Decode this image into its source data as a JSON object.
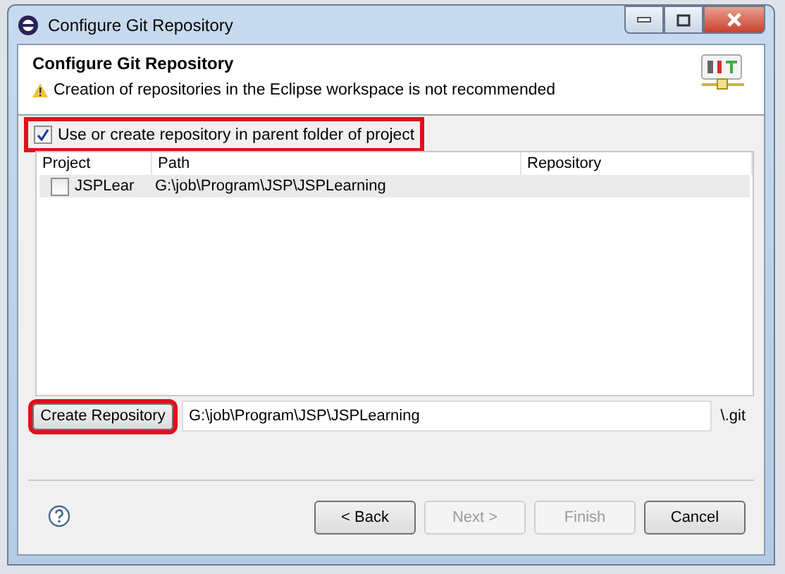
{
  "window": {
    "title": "Configure Git Repository"
  },
  "header": {
    "title": "Configure Git Repository",
    "warning": "Creation of repositories in the Eclipse workspace is not recommended"
  },
  "parent_folder_option": {
    "label": "Use or create repository in parent folder of project",
    "checked": true,
    "highlighted": true
  },
  "table": {
    "columns": [
      "Project",
      "Path",
      "Repository"
    ],
    "rows": [
      {
        "project": "JSPLear",
        "path": "G:\\job\\Program\\JSP\\JSPLearning",
        "checked": false
      }
    ]
  },
  "create_repository": {
    "button": "Create Repository",
    "highlighted": true,
    "value": "G:\\job\\Program\\JSP\\JSPLearning",
    "suffix": "\\.git"
  },
  "buttons": [
    {
      "label": "< Back",
      "disabled": false
    },
    {
      "label": "Next >",
      "disabled": true
    },
    {
      "label": "Finish",
      "disabled": true
    },
    {
      "label": "Cancel",
      "disabled": false
    }
  ]
}
